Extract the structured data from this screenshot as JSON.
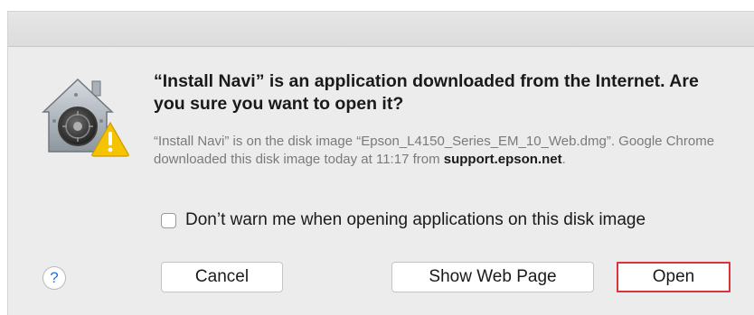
{
  "dialog": {
    "title": "“Install Navi” is an application downloaded from the Internet. Are you sure you want to open it?",
    "info_prefix": "“Install Navi” is on the disk image “Epson_L4150_Series_EM_10_Web.dmg”. Google Chrome downloaded this disk image today at 11:17 from ",
    "info_host": "support.epson.net",
    "info_suffix": ".",
    "checkbox_label": "Don’t warn me when opening applications on this disk image",
    "checkbox_checked": false,
    "help_glyph": "?",
    "buttons": {
      "cancel": "Cancel",
      "show_web_page": "Show Web Page",
      "open": "Open"
    },
    "icons": {
      "app": "gatekeeper-house-icon",
      "warning": "warning-icon",
      "help": "help-icon"
    },
    "colors": {
      "highlight_border": "#d9343a",
      "warning_yellow": "#f5c300",
      "help_blue": "#2a6fd6"
    }
  }
}
